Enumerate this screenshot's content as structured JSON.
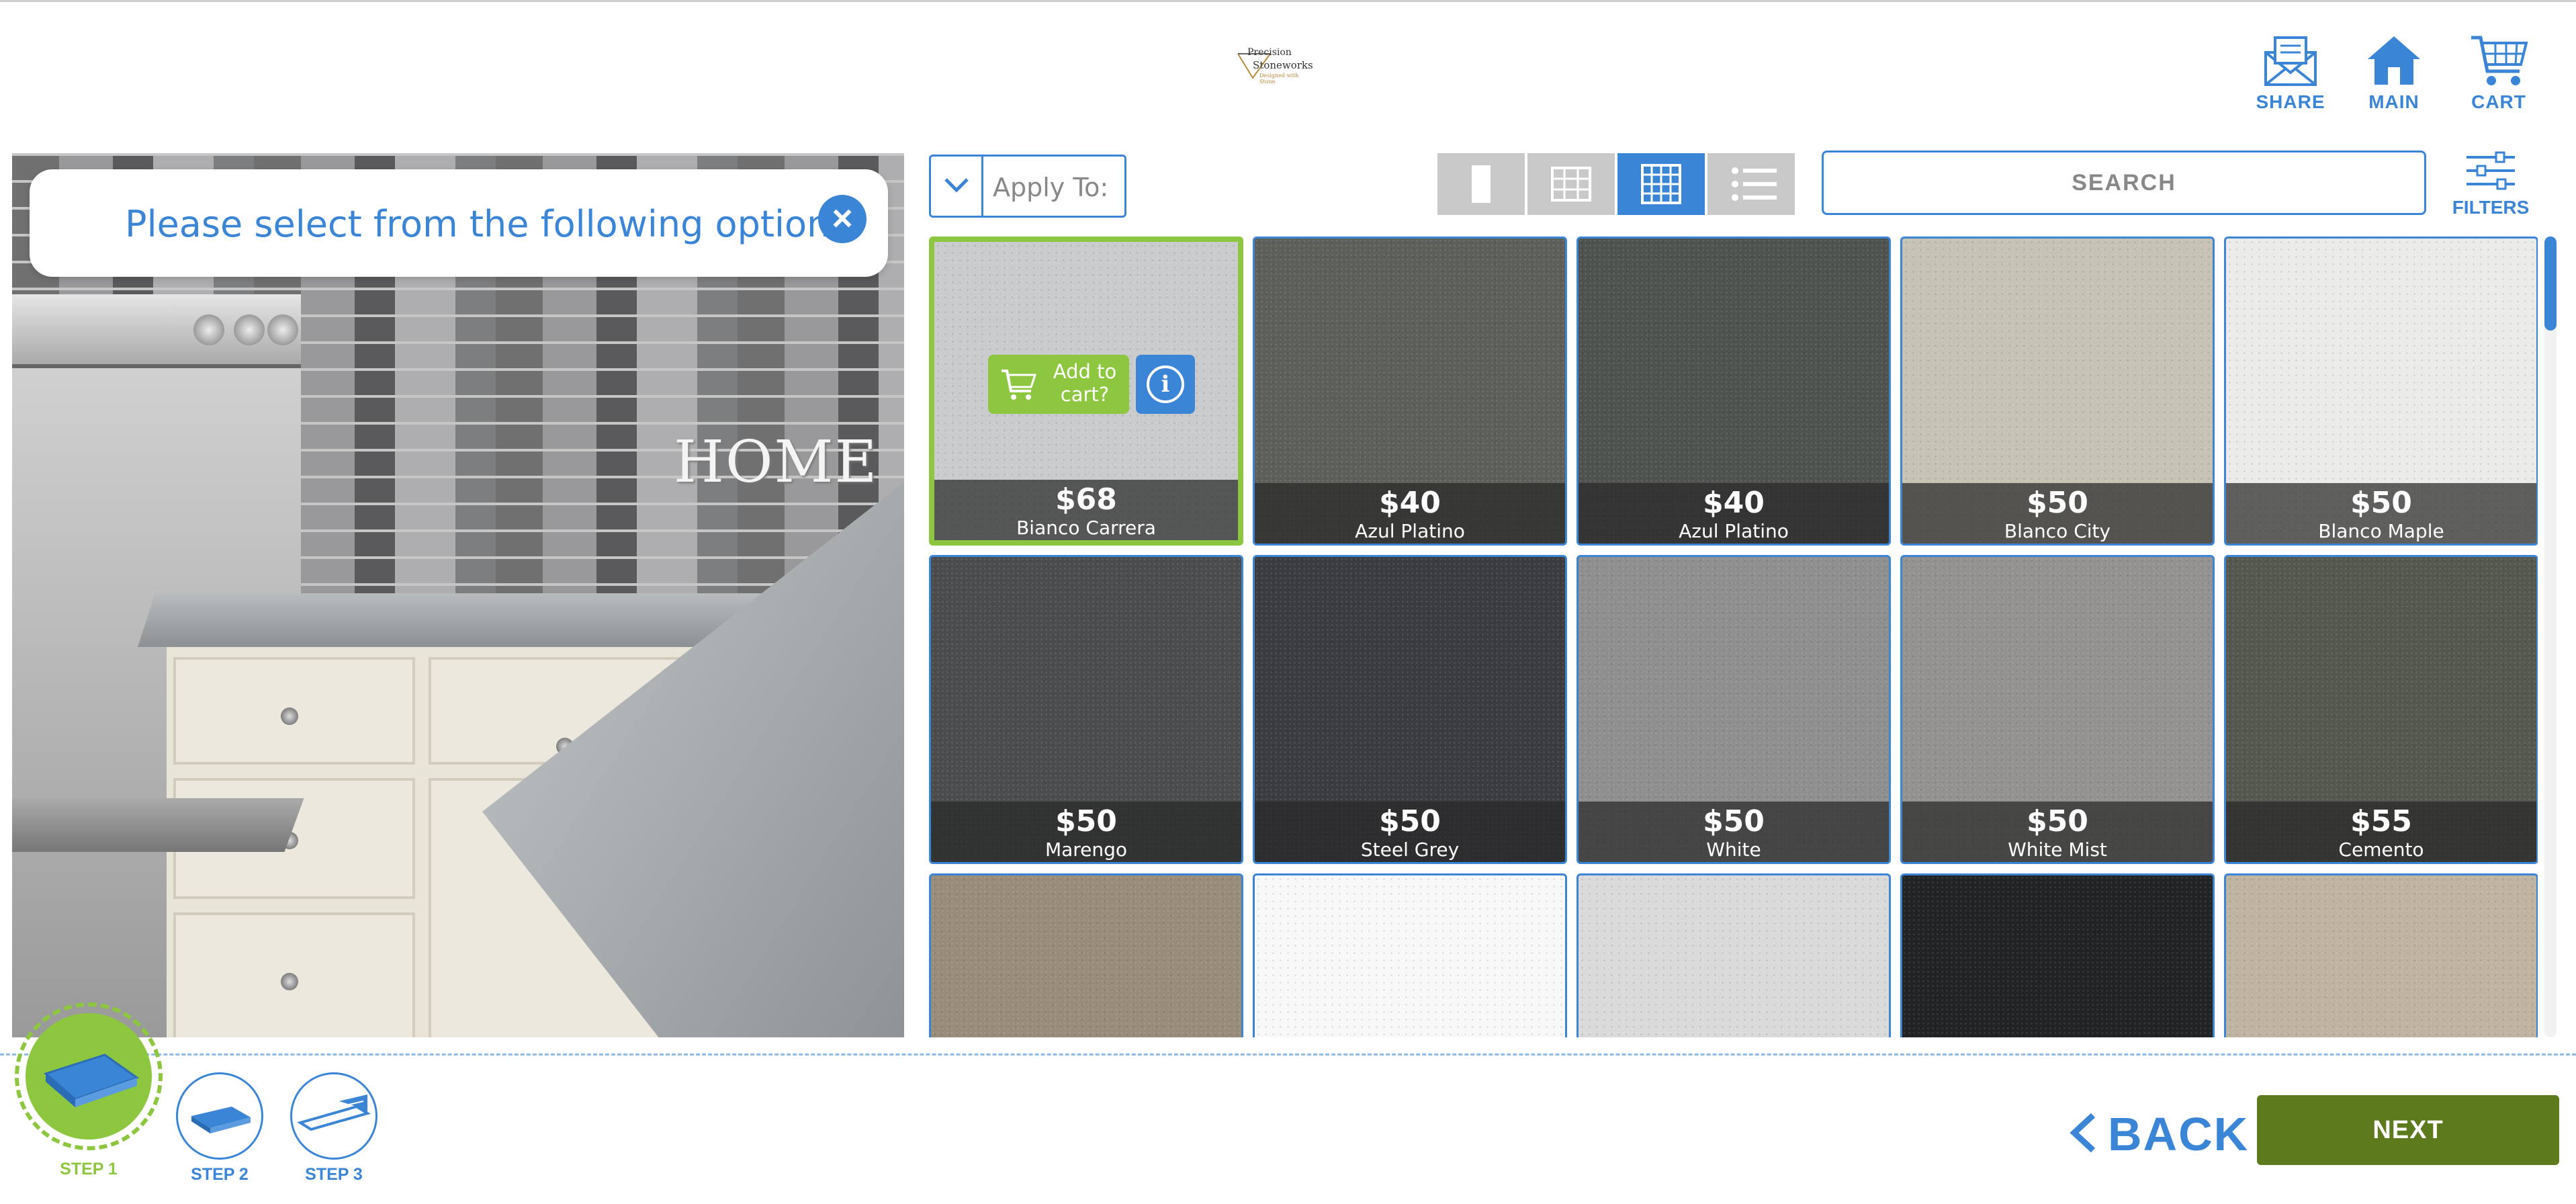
{
  "logo": {
    "line1": "Precision",
    "line2": "Stoneworks",
    "line3": "Designed with Stone"
  },
  "nav": {
    "share": {
      "label": "SHARE",
      "icon": "envelope-icon"
    },
    "main": {
      "label": "MAIN",
      "icon": "home-icon"
    },
    "cart": {
      "label": "CART",
      "icon": "cart-icon"
    }
  },
  "preview": {
    "sign_text": "HOME",
    "popup": {
      "text": "Please select from the following options",
      "close_icon": "close-icon"
    }
  },
  "toolbar": {
    "apply_to": {
      "label": "Apply To:",
      "icon": "chevron-down-icon"
    },
    "view_modes": [
      {
        "name": "single",
        "active": false
      },
      {
        "name": "grid-small",
        "active": false
      },
      {
        "name": "grid-large",
        "active": true
      },
      {
        "name": "list",
        "active": false
      }
    ],
    "search": {
      "label": "SEARCH"
    },
    "filters": {
      "label": "FILTERS",
      "icon": "sliders-icon"
    }
  },
  "grid": {
    "add_to_cart_label": "Add to cart?",
    "info_label": "i",
    "items": [
      {
        "price": "$68",
        "name": "Bianco Carrera",
        "selected": true,
        "color": "#c9cbcc"
      },
      {
        "price": "$40",
        "name": "Azul Platino",
        "selected": false,
        "color": "#5d605a"
      },
      {
        "price": "$40",
        "name": "Azul Platino",
        "selected": false,
        "color": "#4f534f"
      },
      {
        "price": "$50",
        "name": "Blanco City",
        "selected": false,
        "color": "#c6c2b4"
      },
      {
        "price": "$50",
        "name": "Blanco Maple",
        "selected": false,
        "color": "#ebebe9"
      },
      {
        "price": "$50",
        "name": "Marengo",
        "selected": false,
        "color": "#4a4c4e"
      },
      {
        "price": "$50",
        "name": "Steel Grey",
        "selected": false,
        "color": "#3b3c40"
      },
      {
        "price": "$50",
        "name": "White",
        "selected": false,
        "color": "#8f8f8f"
      },
      {
        "price": "$50",
        "name": "White Mist",
        "selected": false,
        "color": "#939291"
      },
      {
        "price": "$55",
        "name": "Cemento",
        "selected": false,
        "color": "#55584f"
      },
      {
        "price": "",
        "name": "",
        "selected": false,
        "color": "#988d7a"
      },
      {
        "price": "",
        "name": "",
        "selected": false,
        "color": "#f8f8f8"
      },
      {
        "price": "",
        "name": "",
        "selected": false,
        "color": "#dadada"
      },
      {
        "price": "",
        "name": "",
        "selected": false,
        "color": "#222325"
      },
      {
        "price": "",
        "name": "",
        "selected": false,
        "color": "#bfb4a2"
      }
    ]
  },
  "steps": [
    {
      "label": "STEP 1",
      "active": true
    },
    {
      "label": "STEP 2",
      "active": false
    },
    {
      "label": "STEP 3",
      "active": false
    }
  ],
  "footer": {
    "back_label": "BACK",
    "next_label": "NEXT"
  },
  "colors": {
    "accent": "#3a85d6",
    "green": "#8dc63f",
    "next": "#5d7a1c"
  }
}
